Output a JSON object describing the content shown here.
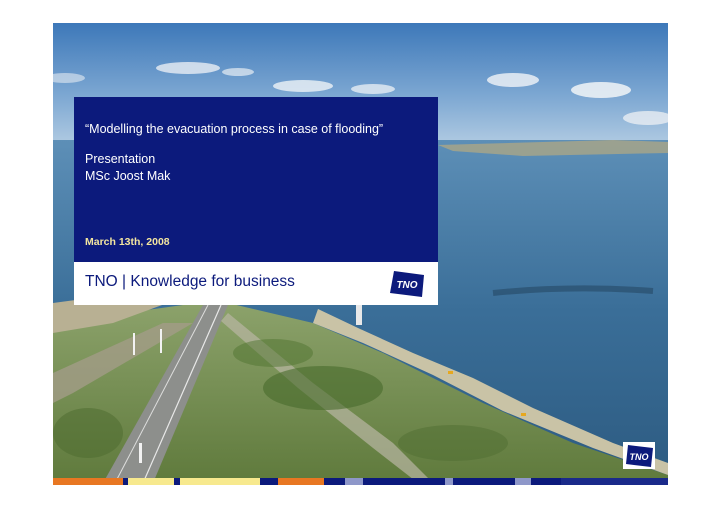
{
  "slide": {
    "title": "“Modelling the evacuation process in case of flooding”",
    "subtitle_line1": "Presentation",
    "subtitle_line2": "MSc Joost Mak",
    "date": "March 13th, 2008",
    "tagline": "TNO | Knowledge for business"
  },
  "logo": {
    "text": "TNO"
  },
  "colors": {
    "brand_blue": "#0c1a7c",
    "date_yellow": "#f3e6a0",
    "strip_orange": "#e87722",
    "strip_yellow": "#f7e98e"
  }
}
